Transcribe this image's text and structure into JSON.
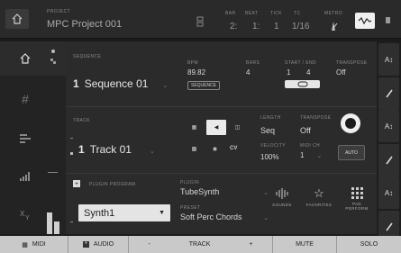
{
  "header": {
    "project_label": "PROJECT",
    "project_name": "MPC Project 001",
    "bar_label": "BAR",
    "beat_label": "BEAT",
    "tick_label": "TICK",
    "tc_label": "TC",
    "metro_label": "METRO",
    "bar_value": "2:",
    "beat_value": "1:",
    "tick_value": "1",
    "tc_value": "1/16"
  },
  "sequence": {
    "label": "SEQUENCE",
    "number": "1",
    "name": "Sequence 01",
    "bpm_label": "BPM",
    "bpm_value": "89.82",
    "bpm_mode": "SEQUENCE",
    "bars_label": "BARS",
    "bars_value": "4",
    "start_end_label": "START / END",
    "start_value": "1",
    "end_value": "4",
    "transpose_label": "TRANSPOSE",
    "transpose_value": "Off"
  },
  "track": {
    "label": "TRACK",
    "number": "1",
    "name": "Track 01",
    "length_label": "LENGTH",
    "length_value": "Seq",
    "transpose_label": "TRANSPOSE",
    "transpose_value": "Off",
    "velocity_label": "VELOCITY",
    "velocity_value": "100%",
    "midi_ch_label": "MIDI CH",
    "midi_ch_value": "1",
    "auto_label": "AUTO",
    "cv_label": "CV"
  },
  "program": {
    "label": "PLUGIN PROGRAM",
    "name": "Synth1",
    "plugin_label": "PLUGIN",
    "plugin_value": "TubeSynth",
    "preset_label": "PRESET",
    "preset_value": "Soft Perc Chords",
    "sounds_label": "SOUNDS",
    "favorites_label": "FAVORITES",
    "pad_perform_label": "PAD\nPERFORM"
  },
  "bottom": {
    "midi": "MIDI",
    "audio": "AUDIO",
    "minus": "-",
    "track": "TRACK",
    "plus": "+",
    "mute": "MUTE",
    "solo": "SOLO"
  },
  "right": {
    "az_label": "A↕"
  }
}
